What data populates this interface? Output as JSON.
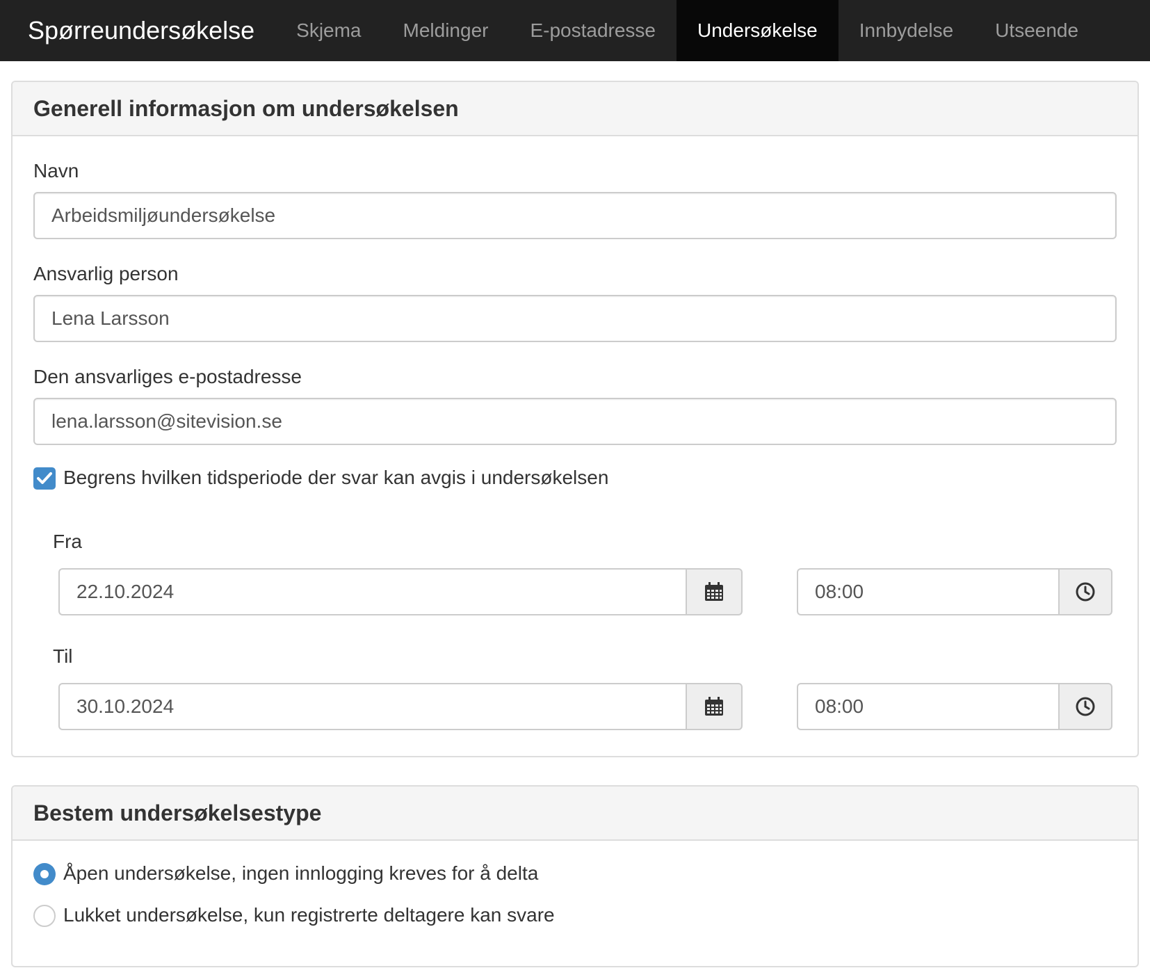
{
  "navbar": {
    "brand": "Spørreundersøkelse",
    "tabs": [
      {
        "label": "Skjema",
        "active": false
      },
      {
        "label": "Meldinger",
        "active": false
      },
      {
        "label": "E-postadresse",
        "active": false
      },
      {
        "label": "Undersøkelse",
        "active": true
      },
      {
        "label": "Innbydelse",
        "active": false
      },
      {
        "label": "Utseende",
        "active": false
      }
    ]
  },
  "general": {
    "heading": "Generell informasjon om undersøkelsen",
    "name_label": "Navn",
    "name_value": "Arbeidsmiljøundersøkelse",
    "responsible_label": "Ansvarlig person",
    "responsible_value": "Lena Larsson",
    "email_label": "Den ansvarliges e-postadresse",
    "email_value": "lena.larsson@sitevision.se",
    "limit_label": "Begrens hvilken tidsperiode der svar kan avgis i undersøkelsen",
    "limit_checked": true,
    "from_label": "Fra",
    "from_date": "22.10.2024",
    "from_time": "08:00",
    "to_label": "Til",
    "to_date": "30.10.2024",
    "to_time": "08:00"
  },
  "type": {
    "heading": "Bestem undersøkelsestype",
    "options": [
      {
        "label": "Åpen undersøkelse, ingen innlogging kreves for å delta",
        "checked": true
      },
      {
        "label": "Lukket undersøkelse, kun registrerte deltagere kan svare",
        "checked": false
      }
    ]
  },
  "colors": {
    "navbar_bg": "#222222",
    "active_tab_bg": "#080808",
    "accent": "#428bca"
  },
  "icons": {
    "date_picker": "calendar-icon",
    "time_picker": "clock-icon",
    "checkbox": "checkmark-icon"
  }
}
